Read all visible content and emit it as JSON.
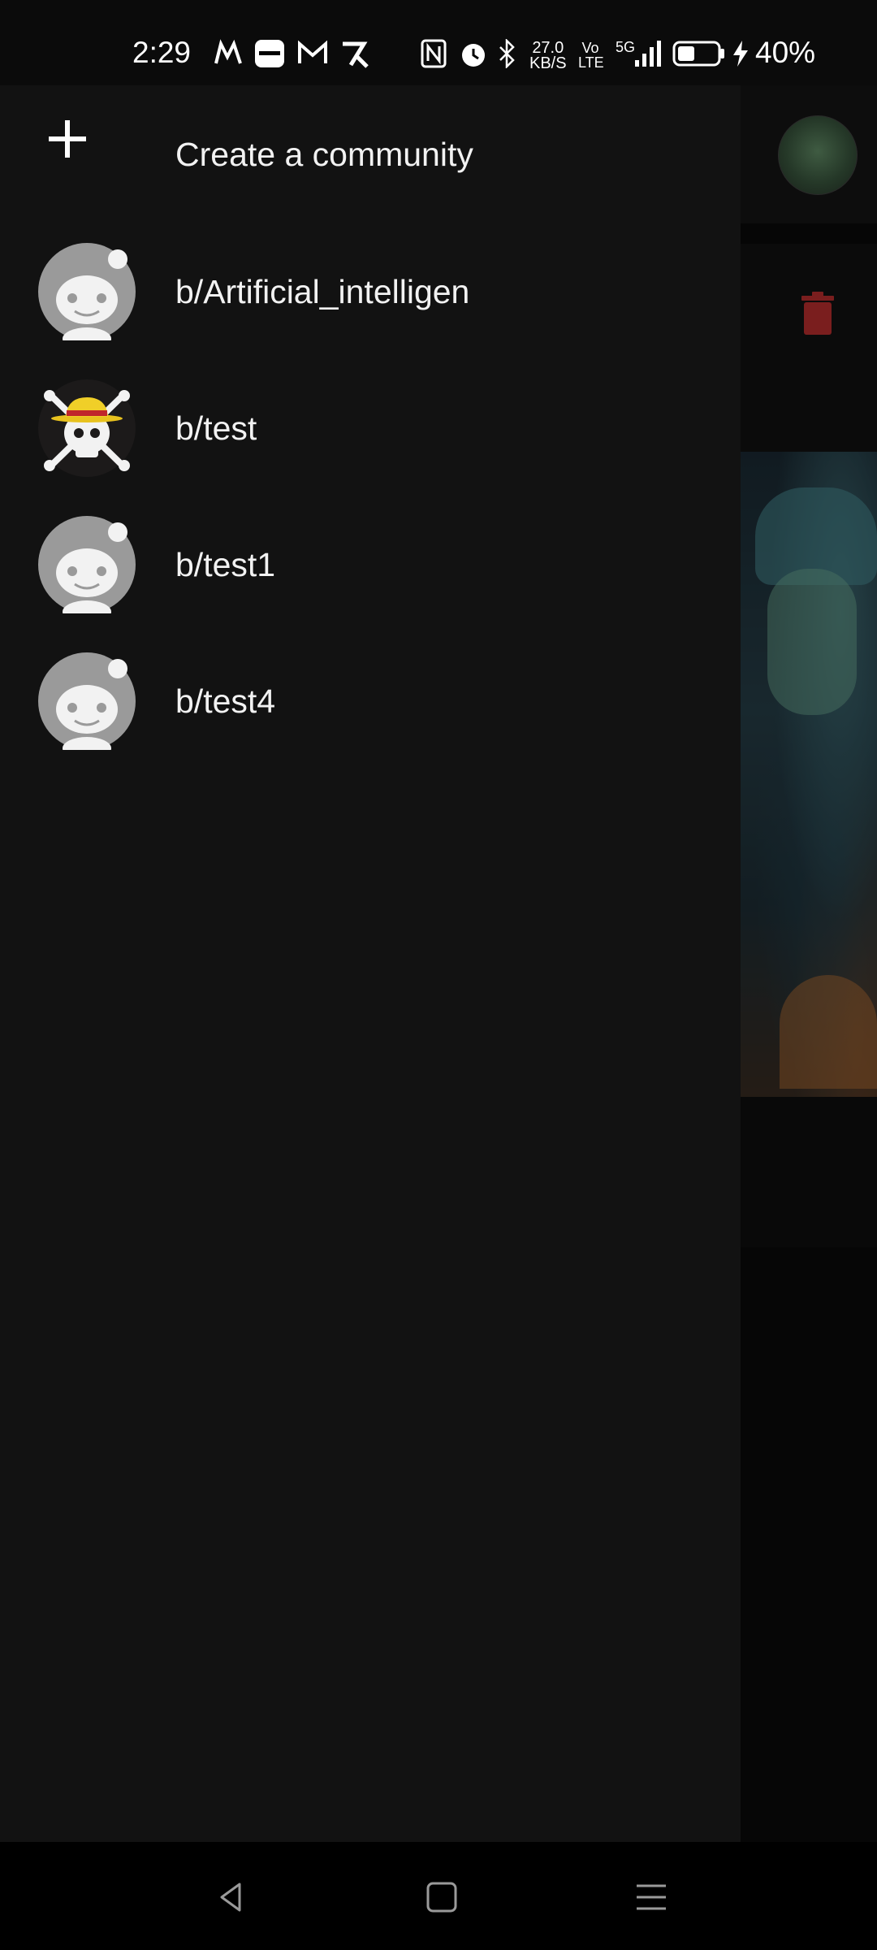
{
  "status_bar": {
    "time": "2:29",
    "net_speed_value": "27.0",
    "net_speed_unit": "KB/S",
    "network": "5G",
    "volte": "Vo LTE",
    "battery": "40%"
  },
  "drawer": {
    "create_label": "Create a community",
    "communities": [
      {
        "label": "b/Artificial_intelligen",
        "avatar": "default-avatar"
      },
      {
        "label": "b/test",
        "avatar": "skull-straw-hat-avatar"
      },
      {
        "label": "b/test1",
        "avatar": "default-avatar"
      },
      {
        "label": "b/test4",
        "avatar": "default-avatar"
      }
    ]
  },
  "icons": {
    "create": "plus-icon",
    "delete": "trash-icon",
    "back": "back-icon",
    "home": "home-icon",
    "recents": "recents-icon"
  },
  "colors": {
    "drawer_bg": "#121212",
    "trash": "#8b1f1f",
    "text": "#f2f2f2"
  }
}
